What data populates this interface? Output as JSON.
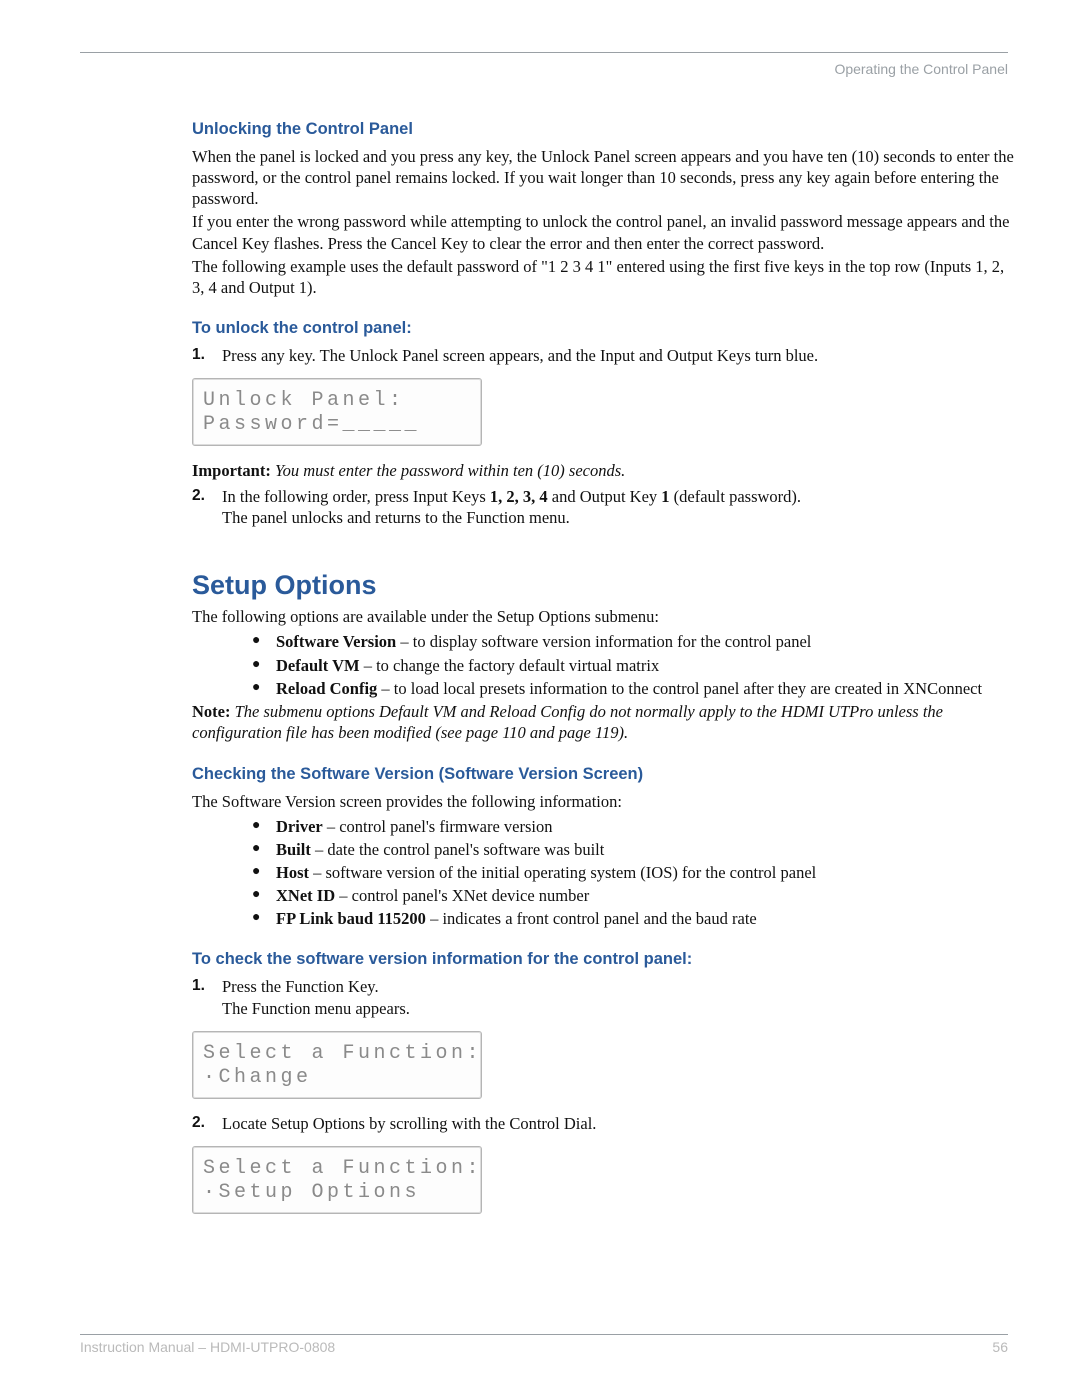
{
  "runHead": "Operating the Control Panel",
  "sec1": {
    "heading": "Unlocking the Control Panel",
    "p1": "When the panel is locked and you press any key, the Unlock Panel screen appears and you have ten (10) seconds to enter the password, or the control panel remains locked. If you wait longer than 10 seconds, press any key again before entering the password.",
    "p2": "If you enter the wrong password while attempting to unlock the control panel, an invalid password message appears and the Cancel Key flashes. Press the Cancel Key to clear the error and then enter the correct password.",
    "p3": "The following example uses the default password of \"1 2 3 4 1\" entered using the first five keys in the top row (Inputs 1, 2, 3, 4 and Output 1)."
  },
  "sec2": {
    "heading": "To unlock the control panel:",
    "step1": {
      "num": "1.",
      "text": "Press any key. The Unlock Panel screen appears, and the Input and Output Keys turn blue."
    },
    "lcd1a": "Unlock Panel:",
    "lcd1b": "Password=_____",
    "importantLabel": "Important:",
    "importantText": " You must enter the password within ten (10) seconds.",
    "step2": {
      "num": "2.",
      "t_a": "In the following order, press Input Keys ",
      "t_b": "1, 2, 3, 4",
      "t_c": " and Output Key ",
      "t_d": "1",
      "t_e": " (default password).",
      "line2": "The panel unlocks and returns to the Function menu."
    }
  },
  "setup": {
    "heading": "Setup Options",
    "intro": "The following options are available under the Setup Options submenu:",
    "items": [
      {
        "b": "Software Version",
        "rest": " – to display software version information for the control panel"
      },
      {
        "b": "Default VM",
        "rest": " – to change the factory default virtual matrix"
      },
      {
        "b": "Reload Config",
        "rest": " – to load local presets information to the control panel after they are created in XNConnect"
      }
    ],
    "noteLabel": "Note:",
    "noteText": " The submenu options Default VM and Reload Config do not normally apply to the HDMI UTPro unless the configuration file has been modified (see page 110 and page 119)."
  },
  "swv": {
    "heading": "Checking the Software Version (Software Version Screen)",
    "intro": "The Software Version screen provides the following information:",
    "items": [
      {
        "b": "Driver",
        "rest": " – control panel's firmware version"
      },
      {
        "b": "Built",
        "rest": " – date the control panel's software was built"
      },
      {
        "b": "Host",
        "rest": " – software version of the initial operating system (IOS) for the control panel"
      },
      {
        "b": "XNet ID",
        "rest": " – control panel's XNet device number"
      },
      {
        "b": "FP Link baud 115200",
        "rest": " – indicates a front control panel and the baud rate"
      }
    ]
  },
  "check": {
    "heading": "To check the software version information for the control panel:",
    "step1": {
      "num": "1.",
      "l1": "Press the Function Key.",
      "l2": "The Function menu appears."
    },
    "lcd2a": "Select a Function:",
    "lcd2b": "·Change",
    "step2": {
      "num": "2.",
      "text": "Locate Setup Options by scrolling with the Control Dial."
    },
    "lcd3a": "Select a Function:",
    "lcd3b": "·Setup Options"
  },
  "footer": {
    "left": "Instruction Manual – HDMI-UTPRO-0808",
    "right": "56"
  }
}
